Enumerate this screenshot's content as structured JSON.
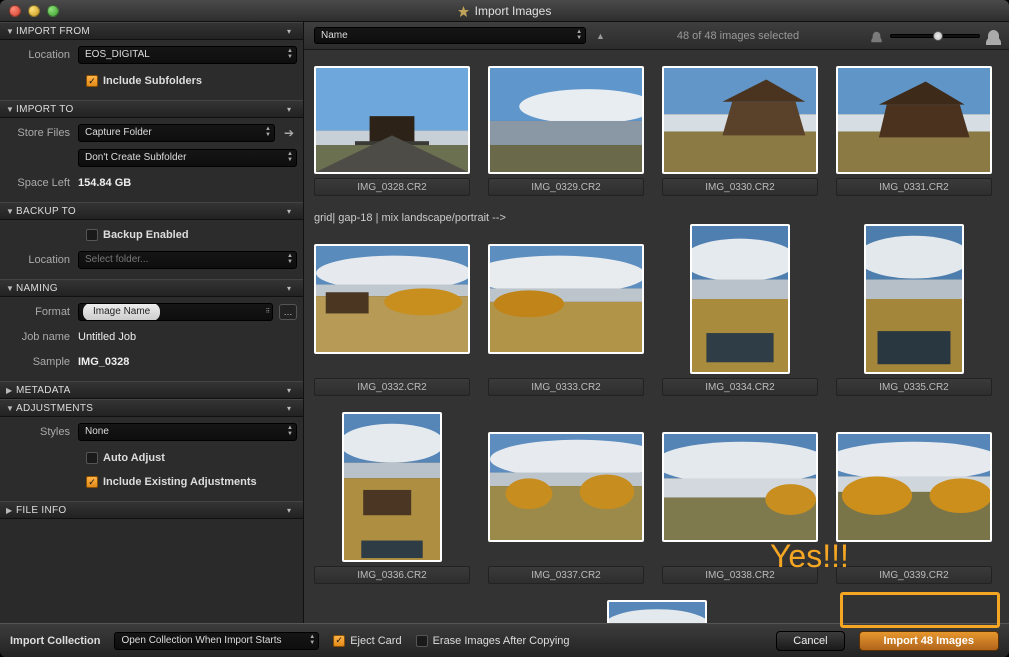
{
  "window": {
    "title": "Import Images"
  },
  "sidebar": {
    "import_from": {
      "heading": "IMPORT FROM",
      "location_label": "Location",
      "location_value": "EOS_DIGITAL",
      "include_subfolders_label": "Include Subfolders",
      "include_subfolders_checked": true
    },
    "import_to": {
      "heading": "IMPORT TO",
      "store_files_label": "Store Files",
      "store_files_value": "Capture Folder",
      "subfolder_value": "Don't Create Subfolder",
      "space_left_label": "Space Left",
      "space_left_value": "154.84 GB"
    },
    "backup_to": {
      "heading": "BACKUP TO",
      "backup_enabled_label": "Backup Enabled",
      "backup_enabled_checked": false,
      "location_label": "Location",
      "location_placeholder": "Select folder..."
    },
    "naming": {
      "heading": "NAMING",
      "format_label": "Format",
      "format_token": "Image Name",
      "job_name_label": "Job name",
      "job_name_value": "Untitled Job",
      "sample_label": "Sample",
      "sample_value": "IMG_0328"
    },
    "metadata": {
      "heading": "METADATA"
    },
    "adjustments": {
      "heading": "ADJUSTMENTS",
      "styles_label": "Styles",
      "styles_value": "None",
      "auto_adjust_label": "Auto Adjust",
      "auto_adjust_checked": false,
      "include_existing_label": "Include Existing Adjustments",
      "include_existing_checked": true
    },
    "file_info": {
      "heading": "FILE INFO"
    }
  },
  "toolbar": {
    "sort_value": "Name",
    "selection_status": "48 of 48 images selected"
  },
  "grid": {
    "row1": [
      "IMG_0328.CR2",
      "IMG_0329.CR2",
      "IMG_0330.CR2",
      "IMG_0331.CR2"
    ],
    "row2": [
      "IMG_0332.CR2",
      "IMG_0333.CR2",
      "IMG_0334.CR2",
      "IMG_0335.CR2"
    ],
    "row3": [
      "IMG_0336.CR2",
      "IMG_0337.CR2",
      "IMG_0338.CR2",
      "IMG_0339.CR2"
    ]
  },
  "footer": {
    "import_collection_label": "Import Collection",
    "import_collection_value": "Open Collection When Import Starts",
    "eject_card_label": "Eject Card",
    "eject_card_checked": true,
    "erase_after_label": "Erase Images After Copying",
    "erase_after_checked": false,
    "cancel_label": "Cancel",
    "import_label": "Import 48 Images"
  },
  "annotation": {
    "text": "Yes!!!"
  }
}
